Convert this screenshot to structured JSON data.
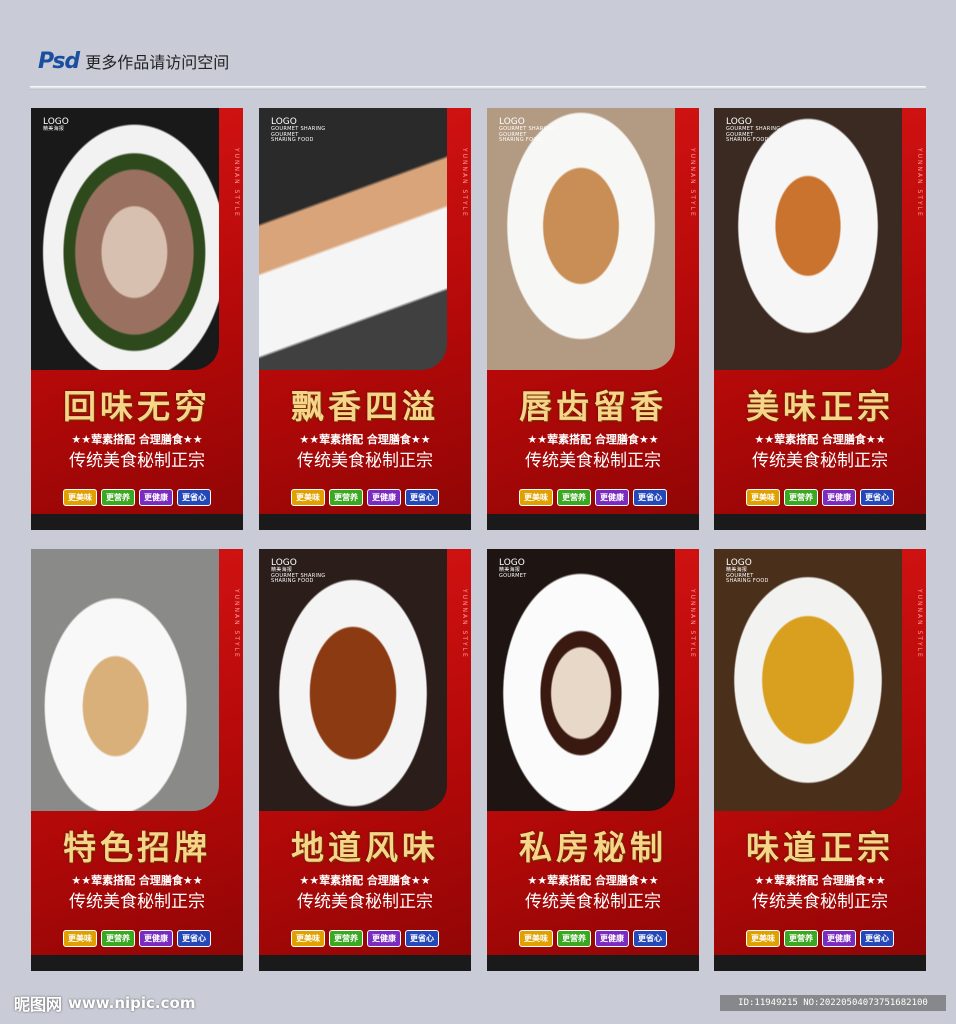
{
  "header": {
    "psd_label": "Psd",
    "text": "更多作品请访问空间"
  },
  "common": {
    "logo": "LOGO",
    "logo_sub_1": "精美海报",
    "logo_sub_2": "GOURMET SHARING",
    "logo_sub_3": "GOURMET",
    "logo_sub_4": "SHARING FOOD",
    "side_text": "YUNNAN STYLE",
    "tagline": "★★荤素搭配 合理膳食★★",
    "subtitle": "传统美食秘制正宗",
    "badges": [
      {
        "label": "更美味",
        "color": "#e0a000"
      },
      {
        "label": "更营养",
        "color": "#3aa820"
      },
      {
        "label": "更健康",
        "color": "#7a2bc0"
      },
      {
        "label": "更省心",
        "color": "#2548b8"
      }
    ]
  },
  "cards": [
    {
      "title": "回味无穷"
    },
    {
      "title": "飘香四溢"
    },
    {
      "title": "唇齿留香"
    },
    {
      "title": "美味正宗"
    },
    {
      "title": "特色招牌"
    },
    {
      "title": "地道风味"
    },
    {
      "title": "私房秘制"
    },
    {
      "title": "味道正宗"
    }
  ],
  "watermark": {
    "site_logo": "昵图网",
    "url": "www.nipic.com",
    "id_text": "ID:11949215 NO:20220504073751682100"
  }
}
